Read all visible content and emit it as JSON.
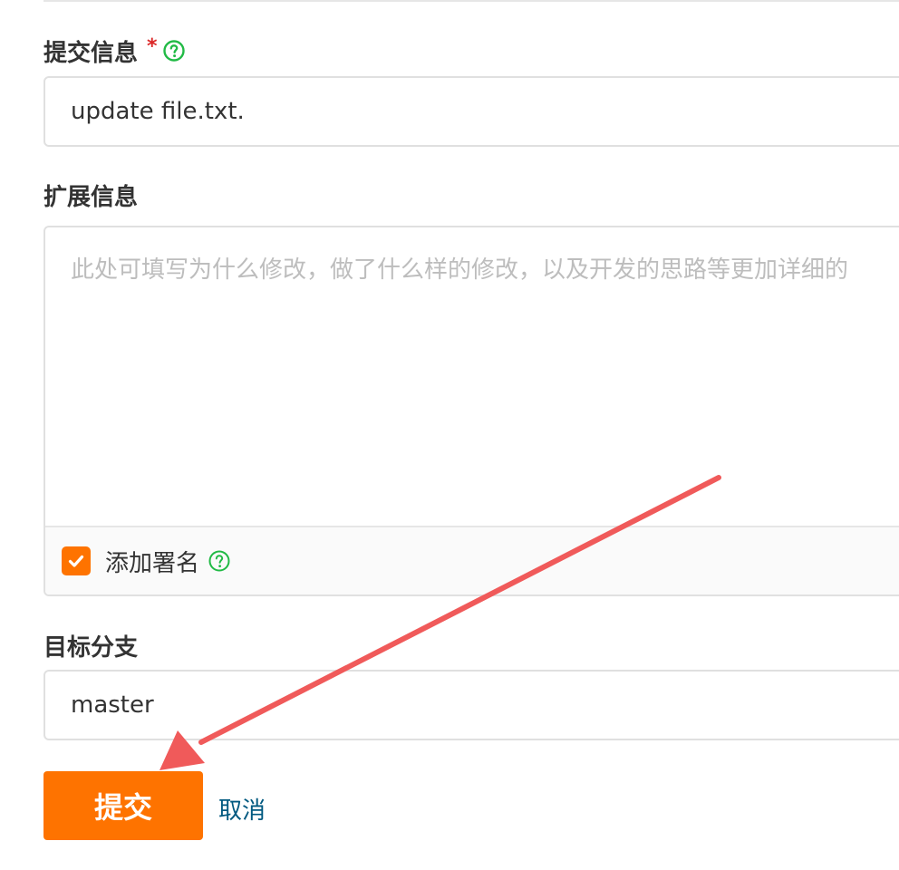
{
  "commit_message": {
    "label": "提交信息",
    "required_mark": "*",
    "help_icon": "question-circle-icon",
    "value": "update file.txt."
  },
  "extended_info": {
    "label": "扩展信息",
    "placeholder": "此处可填写为什么修改，做了什么样的修改，以及开发的思路等更加详细的",
    "add_signature": {
      "label": "添加署名",
      "checked": true,
      "help_icon": "question-circle-icon"
    }
  },
  "target_branch": {
    "label": "目标分支",
    "value": "master"
  },
  "actions": {
    "submit_label": "提交",
    "cancel_label": "取消"
  },
  "colors": {
    "accent": "#fe7300",
    "help_icon": "#21ba45",
    "required": "#db2828",
    "link": "#005980",
    "annotation_arrow": "#f05a5a"
  }
}
